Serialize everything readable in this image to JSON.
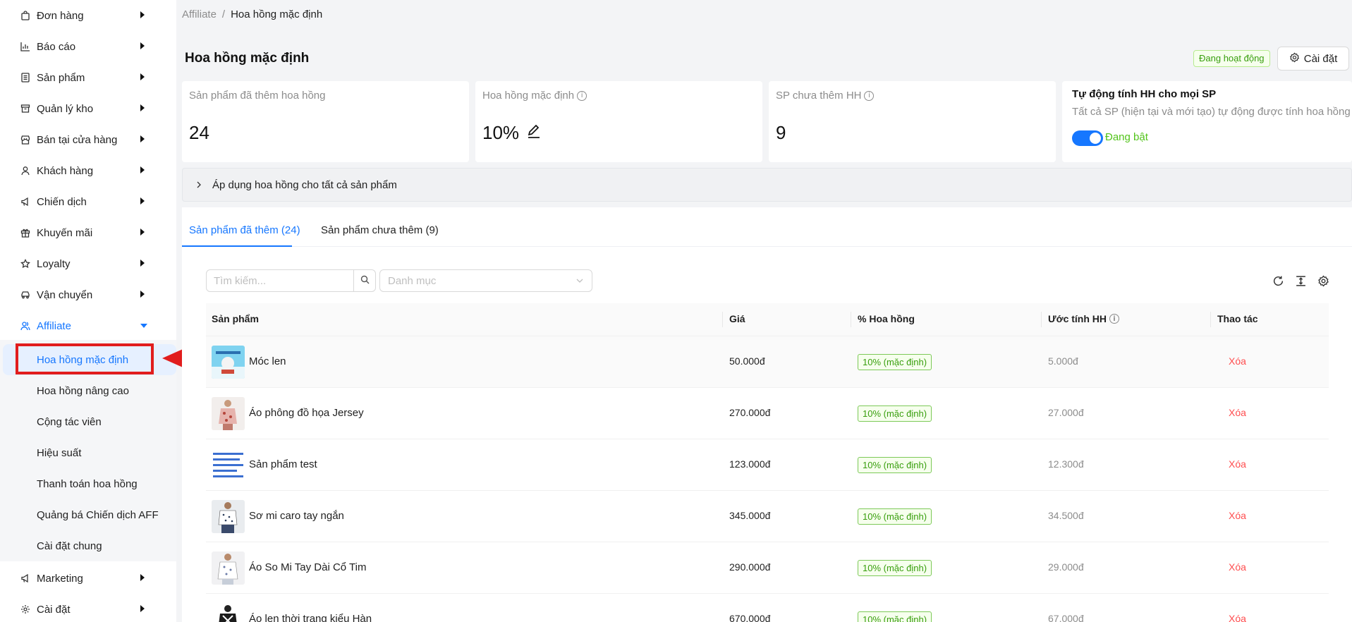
{
  "sidebar": {
    "items": [
      {
        "label": "Đơn hàng",
        "icon": "bag-icon"
      },
      {
        "label": "Báo cáo",
        "icon": "chart-icon"
      },
      {
        "label": "Sản phẩm",
        "icon": "document-icon"
      },
      {
        "label": "Quản lý kho",
        "icon": "archive-icon"
      },
      {
        "label": "Bán tại cửa hàng",
        "icon": "store-icon"
      },
      {
        "label": "Khách hàng",
        "icon": "user-icon"
      },
      {
        "label": "Chiến dịch",
        "icon": "megaphone-icon"
      },
      {
        "label": "Khuyến mãi",
        "icon": "gift-icon"
      },
      {
        "label": "Loyalty",
        "icon": "star-icon"
      },
      {
        "label": "Vận chuyển",
        "icon": "car-icon"
      },
      {
        "label": "Affiliate",
        "icon": "users-icon"
      }
    ],
    "affiliate_sub": [
      "Hoa hồng mặc định",
      "Hoa hồng nâng cao",
      "Cộng tác viên",
      "Hiệu suất",
      "Thanh toán hoa hồng",
      "Quảng bá Chiến dịch AFF",
      "Cài đặt chung"
    ],
    "bottom_items": [
      {
        "label": "Marketing",
        "icon": "megaphone-icon"
      },
      {
        "label": "Cài đặt",
        "icon": "gear-icon"
      }
    ]
  },
  "breadcrumb": {
    "parent": "Affiliate",
    "separator": "/",
    "current": "Hoa hồng mặc định"
  },
  "page": {
    "title": "Hoa hồng mặc định",
    "status": "Đang hoạt động",
    "settings_label": "Cài đặt"
  },
  "stats": {
    "added": {
      "label": "Sản phẩm đã thêm hoa hồng",
      "value": "24"
    },
    "default_rate": {
      "label": "Hoa hồng mặc định",
      "value": "10%"
    },
    "not_added": {
      "label": "SP chưa thêm HH",
      "value": "9"
    },
    "auto": {
      "title": "Tự động tính HH cho mọi SP",
      "desc": "Tất cả SP (hiện tại và mới tạo) tự động được tính hoa hồng",
      "toggle_label": "Đang bật",
      "toggle_on": true
    }
  },
  "apply_all_label": "Áp dụng hoa hồng cho tất cả sản phẩm",
  "tabs": [
    {
      "label": "Sản phẩm đã thêm (24)",
      "active": true
    },
    {
      "label": "Sản phẩm chưa thêm (9)",
      "active": false
    }
  ],
  "filters": {
    "search_placeholder": "Tìm kiếm...",
    "category_placeholder": "Danh mục"
  },
  "table": {
    "columns": [
      "Sản phẩm",
      "Giá",
      "% Hoa hồng",
      "Ước tính HH",
      "Thao tác"
    ],
    "rows": [
      {
        "name": "Móc len",
        "price": "50.000đ",
        "commission": "10% (mặc định)",
        "estimate": "5.000đ",
        "action": "Xóa"
      },
      {
        "name": "Áo phông đồ họa Jersey",
        "price": "270.000đ",
        "commission": "10% (mặc định)",
        "estimate": "27.000đ",
        "action": "Xóa"
      },
      {
        "name": "Sản phẩm test",
        "price": "123.000đ",
        "commission": "10% (mặc định)",
        "estimate": "12.300đ",
        "action": "Xóa"
      },
      {
        "name": "Sơ mi caro tay ngắn",
        "price": "345.000đ",
        "commission": "10% (mặc định)",
        "estimate": "34.500đ",
        "action": "Xóa"
      },
      {
        "name": "Áo So Mi Tay Dài Cổ Tim",
        "price": "290.000đ",
        "commission": "10% (mặc định)",
        "estimate": "29.000đ",
        "action": "Xóa"
      },
      {
        "name": "Áo len thời trang kiểu Hàn",
        "price": "670.000đ",
        "commission": "10% (mặc định)",
        "estimate": "67.000đ",
        "action": "Xóa"
      }
    ]
  },
  "colors": {
    "accent": "#1677ff",
    "success": "#52c41a",
    "danger": "#ff4d4f",
    "annotation": "#e11d1d"
  }
}
